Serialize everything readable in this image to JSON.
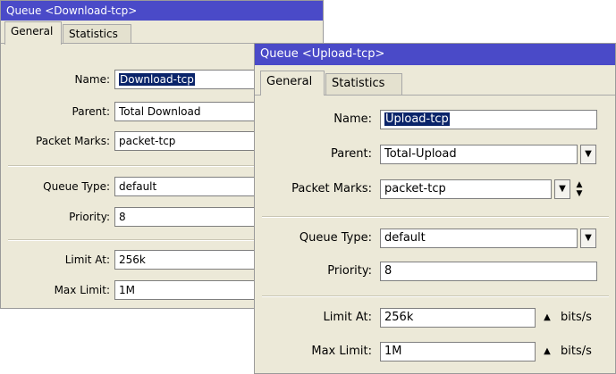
{
  "download": {
    "title": "Queue <Download-tcp>",
    "tabs": [
      {
        "label": "General"
      },
      {
        "label": "Statistics"
      }
    ],
    "fields": {
      "name": {
        "label": "Name:",
        "value": "Download-tcp"
      },
      "parent": {
        "label": "Parent:",
        "value": "Total Download"
      },
      "packet_marks": {
        "label": "Packet Marks:",
        "value": "packet-tcp"
      },
      "queue_type": {
        "label": "Queue Type:",
        "value": "default"
      },
      "priority": {
        "label": "Priority:",
        "value": "8"
      },
      "limit_at": {
        "label": "Limit At:",
        "value": "256k"
      },
      "max_limit": {
        "label": "Max Limit:",
        "value": "1M"
      }
    }
  },
  "upload": {
    "title": "Queue <Upload-tcp>",
    "tabs": [
      {
        "label": "General"
      },
      {
        "label": "Statistics"
      }
    ],
    "fields": {
      "name": {
        "label": "Name:",
        "value": "Upload-tcp"
      },
      "parent": {
        "label": "Parent:",
        "value": "Total-Upload"
      },
      "packet_marks": {
        "label": "Packet Marks:",
        "value": "packet-tcp"
      },
      "queue_type": {
        "label": "Queue Type:",
        "value": "default"
      },
      "priority": {
        "label": "Priority:",
        "value": "8"
      },
      "limit_at": {
        "label": "Limit At:",
        "value": "256k",
        "unit": "bits/s"
      },
      "max_limit": {
        "label": "Max Limit:",
        "value": "1M",
        "unit": "bits/s"
      }
    }
  },
  "icons": {
    "dropdown": "▼",
    "up": "▲",
    "updown": "▲▼"
  }
}
